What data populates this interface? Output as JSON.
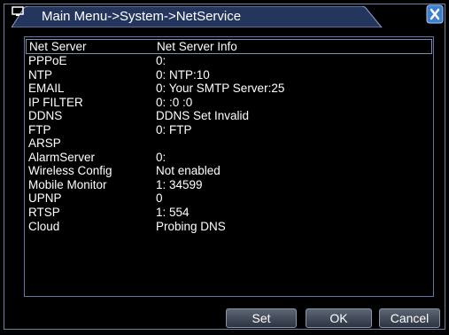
{
  "window": {
    "title": "Main Menu->System->NetService",
    "close_icon": "close-icon",
    "title_icon": "monitor-icon"
  },
  "table": {
    "headers": [
      "Net Server",
      "Net Server Info"
    ],
    "rows": [
      {
        "server": "PPPoE",
        "info": "0:"
      },
      {
        "server": "NTP",
        "info": "0: NTP:10"
      },
      {
        "server": "EMAIL",
        "info": "0: Your SMTP Server:25"
      },
      {
        "server": "IP FILTER",
        "info": "0: :0 :0"
      },
      {
        "server": "DDNS",
        "info": "DDNS Set Invalid"
      },
      {
        "server": "FTP",
        "info": "0: FTP"
      },
      {
        "server": "ARSP",
        "info": ""
      },
      {
        "server": "AlarmServer",
        "info": "0:"
      },
      {
        "server": "Wireless Config",
        "info": "Not enabled"
      },
      {
        "server": "Mobile Monitor",
        "info": "1: 34599"
      },
      {
        "server": "UPNP",
        "info": "0"
      },
      {
        "server": "RTSP",
        "info": "1: 554"
      },
      {
        "server": "Cloud",
        "info": "Probing DNS"
      }
    ]
  },
  "buttons": {
    "set": "Set",
    "ok": "OK",
    "cancel": "Cancel"
  },
  "colors": {
    "background": "#000000",
    "border": "#6f84a8",
    "title_tab": "#2c3f6e",
    "close": "#4a8ad8"
  }
}
